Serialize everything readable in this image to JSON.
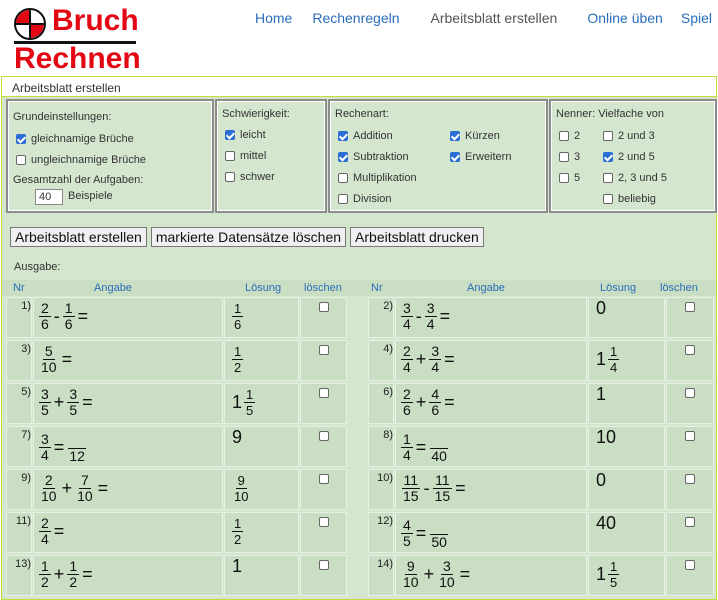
{
  "logo": {
    "line1": "Bruch",
    "line2": "Rechnen"
  },
  "nav": [
    "Home",
    "Rechenregeln",
    "Arbeitsblatt erstellen",
    "Online üben",
    "Spiel"
  ],
  "page": {
    "title": "Arbeitsblatt erstellen"
  },
  "settings": {
    "grund": {
      "caption": "Grundeinstellungen:",
      "opt1": "gleichnamige Brüche",
      "opt2": "ungleichnamige Brüche",
      "total_label": "Gesamtzahl der Aufgaben:",
      "total_value": "40",
      "total_unit": "Beispiele"
    },
    "schwierigkeit": {
      "caption": "Schwierigkeit:",
      "o1": "leicht",
      "o2": "mittel",
      "o3": "schwer"
    },
    "rechenart": {
      "caption": "Rechenart:",
      "o1": "Addition",
      "o2": "Subtraktion",
      "o3": "Multiplikation",
      "o4": "Division",
      "o5": "Kürzen",
      "o6": "Erweitern"
    },
    "nenner": {
      "caption": "Nenner: Vielfache von",
      "o1": "2",
      "o2": "3",
      "o3": "5",
      "o4": "2 und 3",
      "o5": "2 und 5",
      "o6": "2, 3 und 5",
      "o7": "beliebig"
    }
  },
  "buttons": {
    "create": "Arbeitsblatt erstellen",
    "delete": "markierte Datensätze löschen",
    "print": "Arbeitsblatt drucken"
  },
  "output": {
    "label": "Ausgabe:",
    "headers": {
      "nr": "Nr",
      "angabe": "Angabe",
      "loesung": "Lösung",
      "loeschen": "löschen"
    },
    "rows": [
      {
        "nr_l": "1)",
        "nr_r": "2)"
      },
      {
        "nr_l": "3)",
        "nr_r": "4)"
      },
      {
        "nr_l": "5)",
        "nr_r": "6)"
      },
      {
        "nr_l": "7)",
        "nr_r": "8)"
      },
      {
        "nr_l": "9)",
        "nr_r": "10)"
      },
      {
        "nr_l": "11)",
        "nr_r": "12)"
      },
      {
        "nr_l": "13)",
        "nr_r": "14)"
      }
    ],
    "tasks": {
      "t1": {
        "a": "2",
        "b": "6",
        "op": "-",
        "c": "1",
        "d": "6",
        "eq": "=",
        "s_n": "1",
        "s_d": "6"
      },
      "t2": {
        "a": "3",
        "b": "4",
        "op": "-",
        "c": "3",
        "d": "4",
        "eq": "=",
        "sol": "0"
      },
      "t3": {
        "a": "5",
        "b": "10",
        "eq": "=",
        "s_n": "1",
        "s_d": "2"
      },
      "t4": {
        "a": "2",
        "b": "4",
        "op": "+",
        "c": "3",
        "d": "4",
        "eq": "=",
        "s_w": "1",
        "s_n": "1",
        "s_d": "4"
      },
      "t5": {
        "a": "3",
        "b": "5",
        "op": "+",
        "c": "3",
        "d": "5",
        "eq": "=",
        "s_w": "1",
        "s_n": "1",
        "s_d": "5"
      },
      "t6": {
        "a": "2",
        "b": "6",
        "op": "+",
        "c": "4",
        "d": "6",
        "eq": "=",
        "sol": "1"
      },
      "t7": {
        "a": "3",
        "b": "4",
        "eq": "=",
        "d2": "12",
        "sol": "9"
      },
      "t8": {
        "a": "1",
        "b": "4",
        "eq": "=",
        "d2": "40",
        "sol": "10"
      },
      "t9": {
        "a": "2",
        "b": "10",
        "op": "+",
        "c": "7",
        "d": "10",
        "eq": "=",
        "s_n": "9",
        "s_d": "10"
      },
      "t10": {
        "a": "11",
        "b": "15",
        "op": "-",
        "c": "11",
        "d": "15",
        "eq": "=",
        "sol": "0"
      },
      "t11": {
        "a": "2",
        "b": "4",
        "eq": "=",
        "s_n": "1",
        "s_d": "2"
      },
      "t12": {
        "a": "4",
        "b": "5",
        "eq": "=",
        "d2": "50",
        "sol": "40"
      },
      "t13": {
        "a": "1",
        "b": "2",
        "op": "+",
        "c": "1",
        "d": "2",
        "eq": "=",
        "sol": "1"
      },
      "t14": {
        "a": "9",
        "b": "10",
        "op": "+",
        "c": "3",
        "d": "10",
        "eq": "=",
        "s_w": "1",
        "s_n": "1",
        "s_d": "5"
      }
    }
  },
  "colors": {
    "accent": "#e30613",
    "link": "#2a6ebb",
    "panel": "#d5e6cf",
    "check": "#2b6fd6"
  }
}
